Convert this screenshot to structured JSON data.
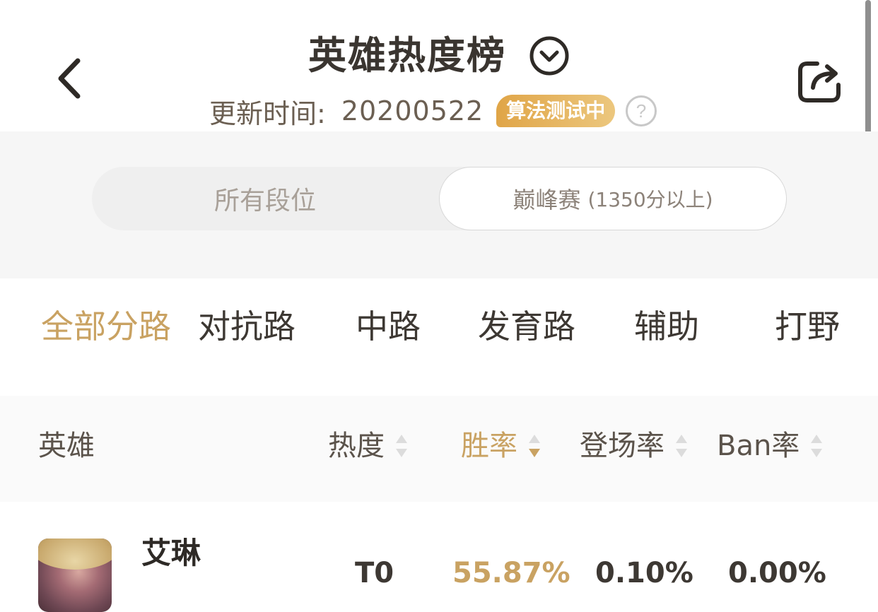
{
  "header": {
    "title": "英雄热度榜",
    "update_label": "更新时间:",
    "update_date": "20200522",
    "badge": "算法测试中"
  },
  "segments": {
    "all": "所有段位",
    "peak": "巅峰赛",
    "peak_note": "(1350分以上)"
  },
  "lanes": [
    "全部分路",
    "对抗路",
    "中路",
    "发育路",
    "辅助",
    "打野"
  ],
  "table": {
    "columns": [
      "英雄",
      "热度",
      "胜率",
      "登场率",
      "Ban率"
    ],
    "rows": [
      {
        "name": "艾琳",
        "tier": "T0",
        "win_rate": "55.87%",
        "pick_rate": "0.10%",
        "ban_rate": "0.00%"
      }
    ]
  },
  "colors": {
    "accent": "#c9a262",
    "badge_start": "#e0a547",
    "badge_end": "#ecc77e",
    "text_dark": "#3a3530"
  }
}
